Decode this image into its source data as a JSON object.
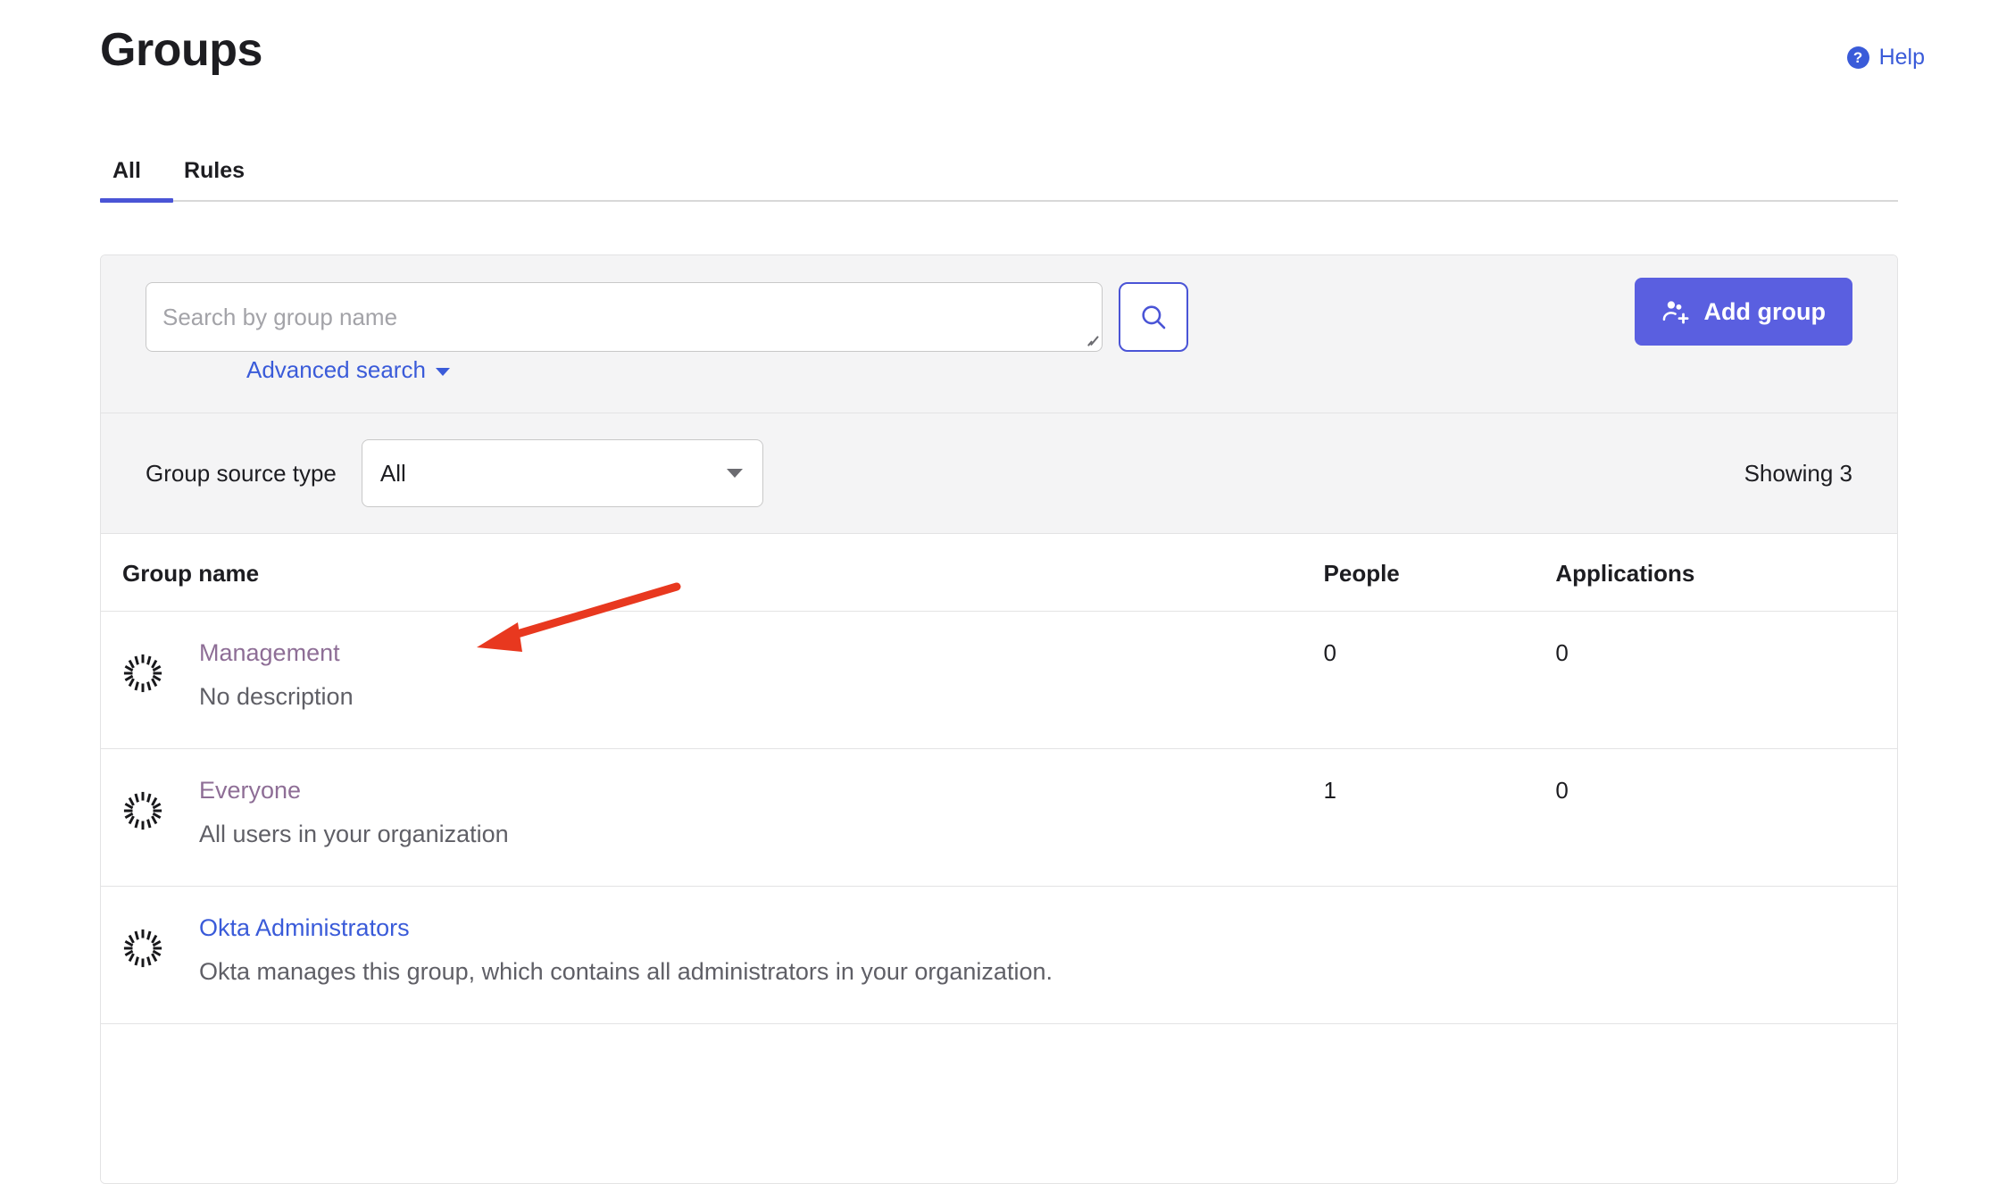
{
  "header": {
    "title": "Groups",
    "help_label": "Help",
    "help_icon": "question-mark-circle-icon"
  },
  "tabs": [
    {
      "label": "All",
      "active": true
    },
    {
      "label": "Rules",
      "active": false
    }
  ],
  "search": {
    "placeholder": "Search by group name",
    "value": "",
    "search_icon": "magnifying-glass-icon",
    "advanced_search_label": "Advanced search",
    "advanced_search_caret": "caret-down-icon",
    "add_group_label": "Add group",
    "add_group_icon": "person-add-icon"
  },
  "filter": {
    "label": "Group source type",
    "selected": "All",
    "options": [
      "All"
    ],
    "showing": "Showing 3"
  },
  "table": {
    "columns": {
      "group_name": "Group name",
      "people": "People",
      "applications": "Applications"
    },
    "rows": [
      {
        "icon": "okta-sunburst-icon",
        "name": "Management",
        "description": "No description",
        "people": "0",
        "applications": "0",
        "visited": true
      },
      {
        "icon": "okta-sunburst-icon",
        "name": "Everyone",
        "description": "All users in your organization",
        "people": "1",
        "applications": "0",
        "visited": true
      },
      {
        "icon": "okta-sunburst-icon",
        "name": "Okta Administrators",
        "description": "Okta manages this group, which contains all administrators in your organization.",
        "people": "",
        "applications": "",
        "visited": false
      }
    ]
  },
  "colors": {
    "accent_blue": "#3A5BD9",
    "button_blue": "#5A5FE0",
    "tab_underline": "#4A54D6",
    "visited_link": "#8E6E96",
    "annotation_red": "#E8381F",
    "panel_gray": "#F4F4F5"
  }
}
